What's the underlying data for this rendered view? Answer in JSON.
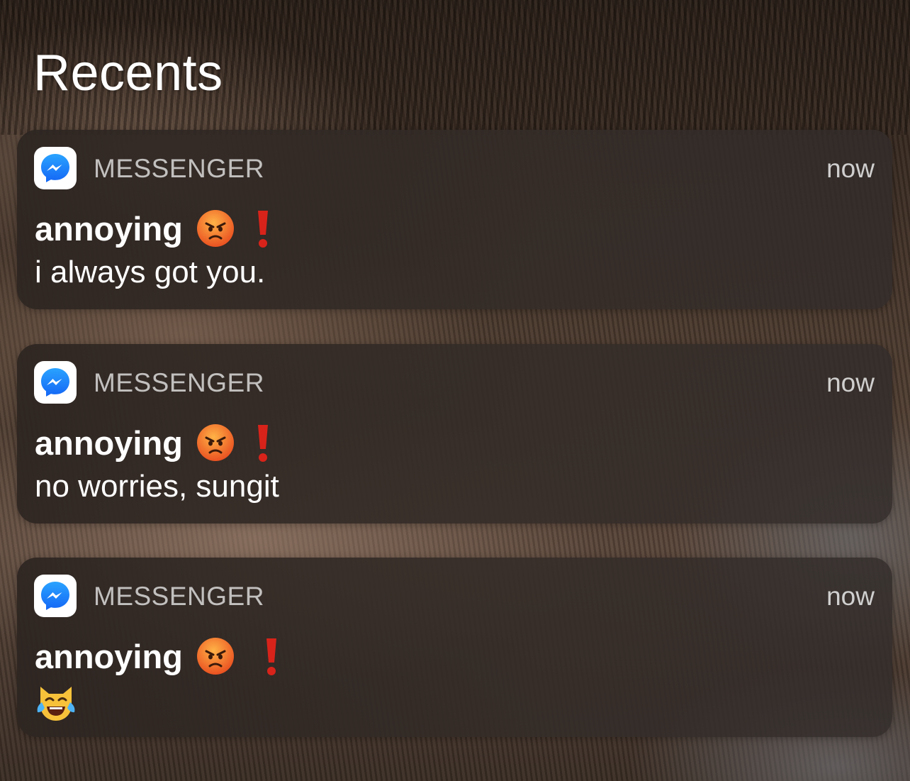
{
  "header": {
    "title": "Recents"
  },
  "notifications": [
    {
      "app": "MESSENGER",
      "time": "now",
      "sender": "annoying",
      "message": "i always got you."
    },
    {
      "app": "MESSENGER",
      "time": "now",
      "sender": "annoying",
      "message": "no worries, sungit"
    },
    {
      "app": "MESSENGER",
      "time": "now",
      "sender": "annoying",
      "message": ""
    }
  ],
  "icons": {
    "app": "messenger-app-icon",
    "sender_emoji_1": "pouting-face-emoji",
    "sender_emoji_2": "red-exclamation-mark",
    "message_3_emoji": "cat-with-tears-of-joy-emoji"
  },
  "colors": {
    "messenger_blue": "#1E8CFF",
    "exclamation_red": "#D8231A",
    "angry_face": "#E84A1E"
  }
}
